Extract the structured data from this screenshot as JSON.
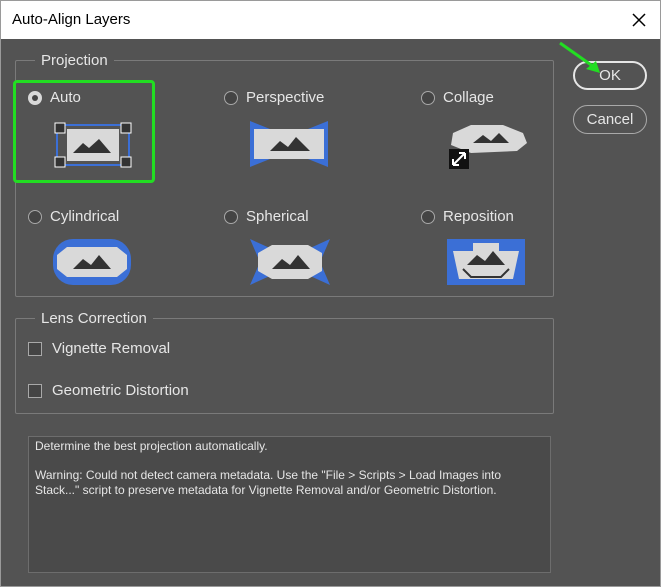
{
  "window": {
    "title": "Auto-Align Layers"
  },
  "projection": {
    "legend": "Projection",
    "options": [
      {
        "label": "Auto",
        "selected": true,
        "icon": "auto-projection-icon"
      },
      {
        "label": "Perspective",
        "selected": false,
        "icon": "perspective-projection-icon"
      },
      {
        "label": "Collage",
        "selected": false,
        "icon": "collage-projection-icon"
      },
      {
        "label": "Cylindrical",
        "selected": false,
        "icon": "cylindrical-projection-icon"
      },
      {
        "label": "Spherical",
        "selected": false,
        "icon": "spherical-projection-icon"
      },
      {
        "label": "Reposition",
        "selected": false,
        "icon": "reposition-projection-icon"
      }
    ]
  },
  "lens_correction": {
    "legend": "Lens Correction",
    "options": [
      {
        "label": "Vignette Removal",
        "checked": false
      },
      {
        "label": "Geometric Distortion",
        "checked": false
      }
    ]
  },
  "buttons": {
    "ok": "OK",
    "cancel": "Cancel"
  },
  "description": {
    "line1": "Determine the best projection automatically.",
    "line2": "Warning: Could not detect camera metadata. Use the \"File > Scripts > Load Images into Stack...\" script to preserve metadata for Vignette Removal and/or Geometric Distortion."
  },
  "colors": {
    "accent_blue": "#3b6fd6",
    "highlight_green": "#22dd22",
    "panel_gray": "#535353"
  }
}
